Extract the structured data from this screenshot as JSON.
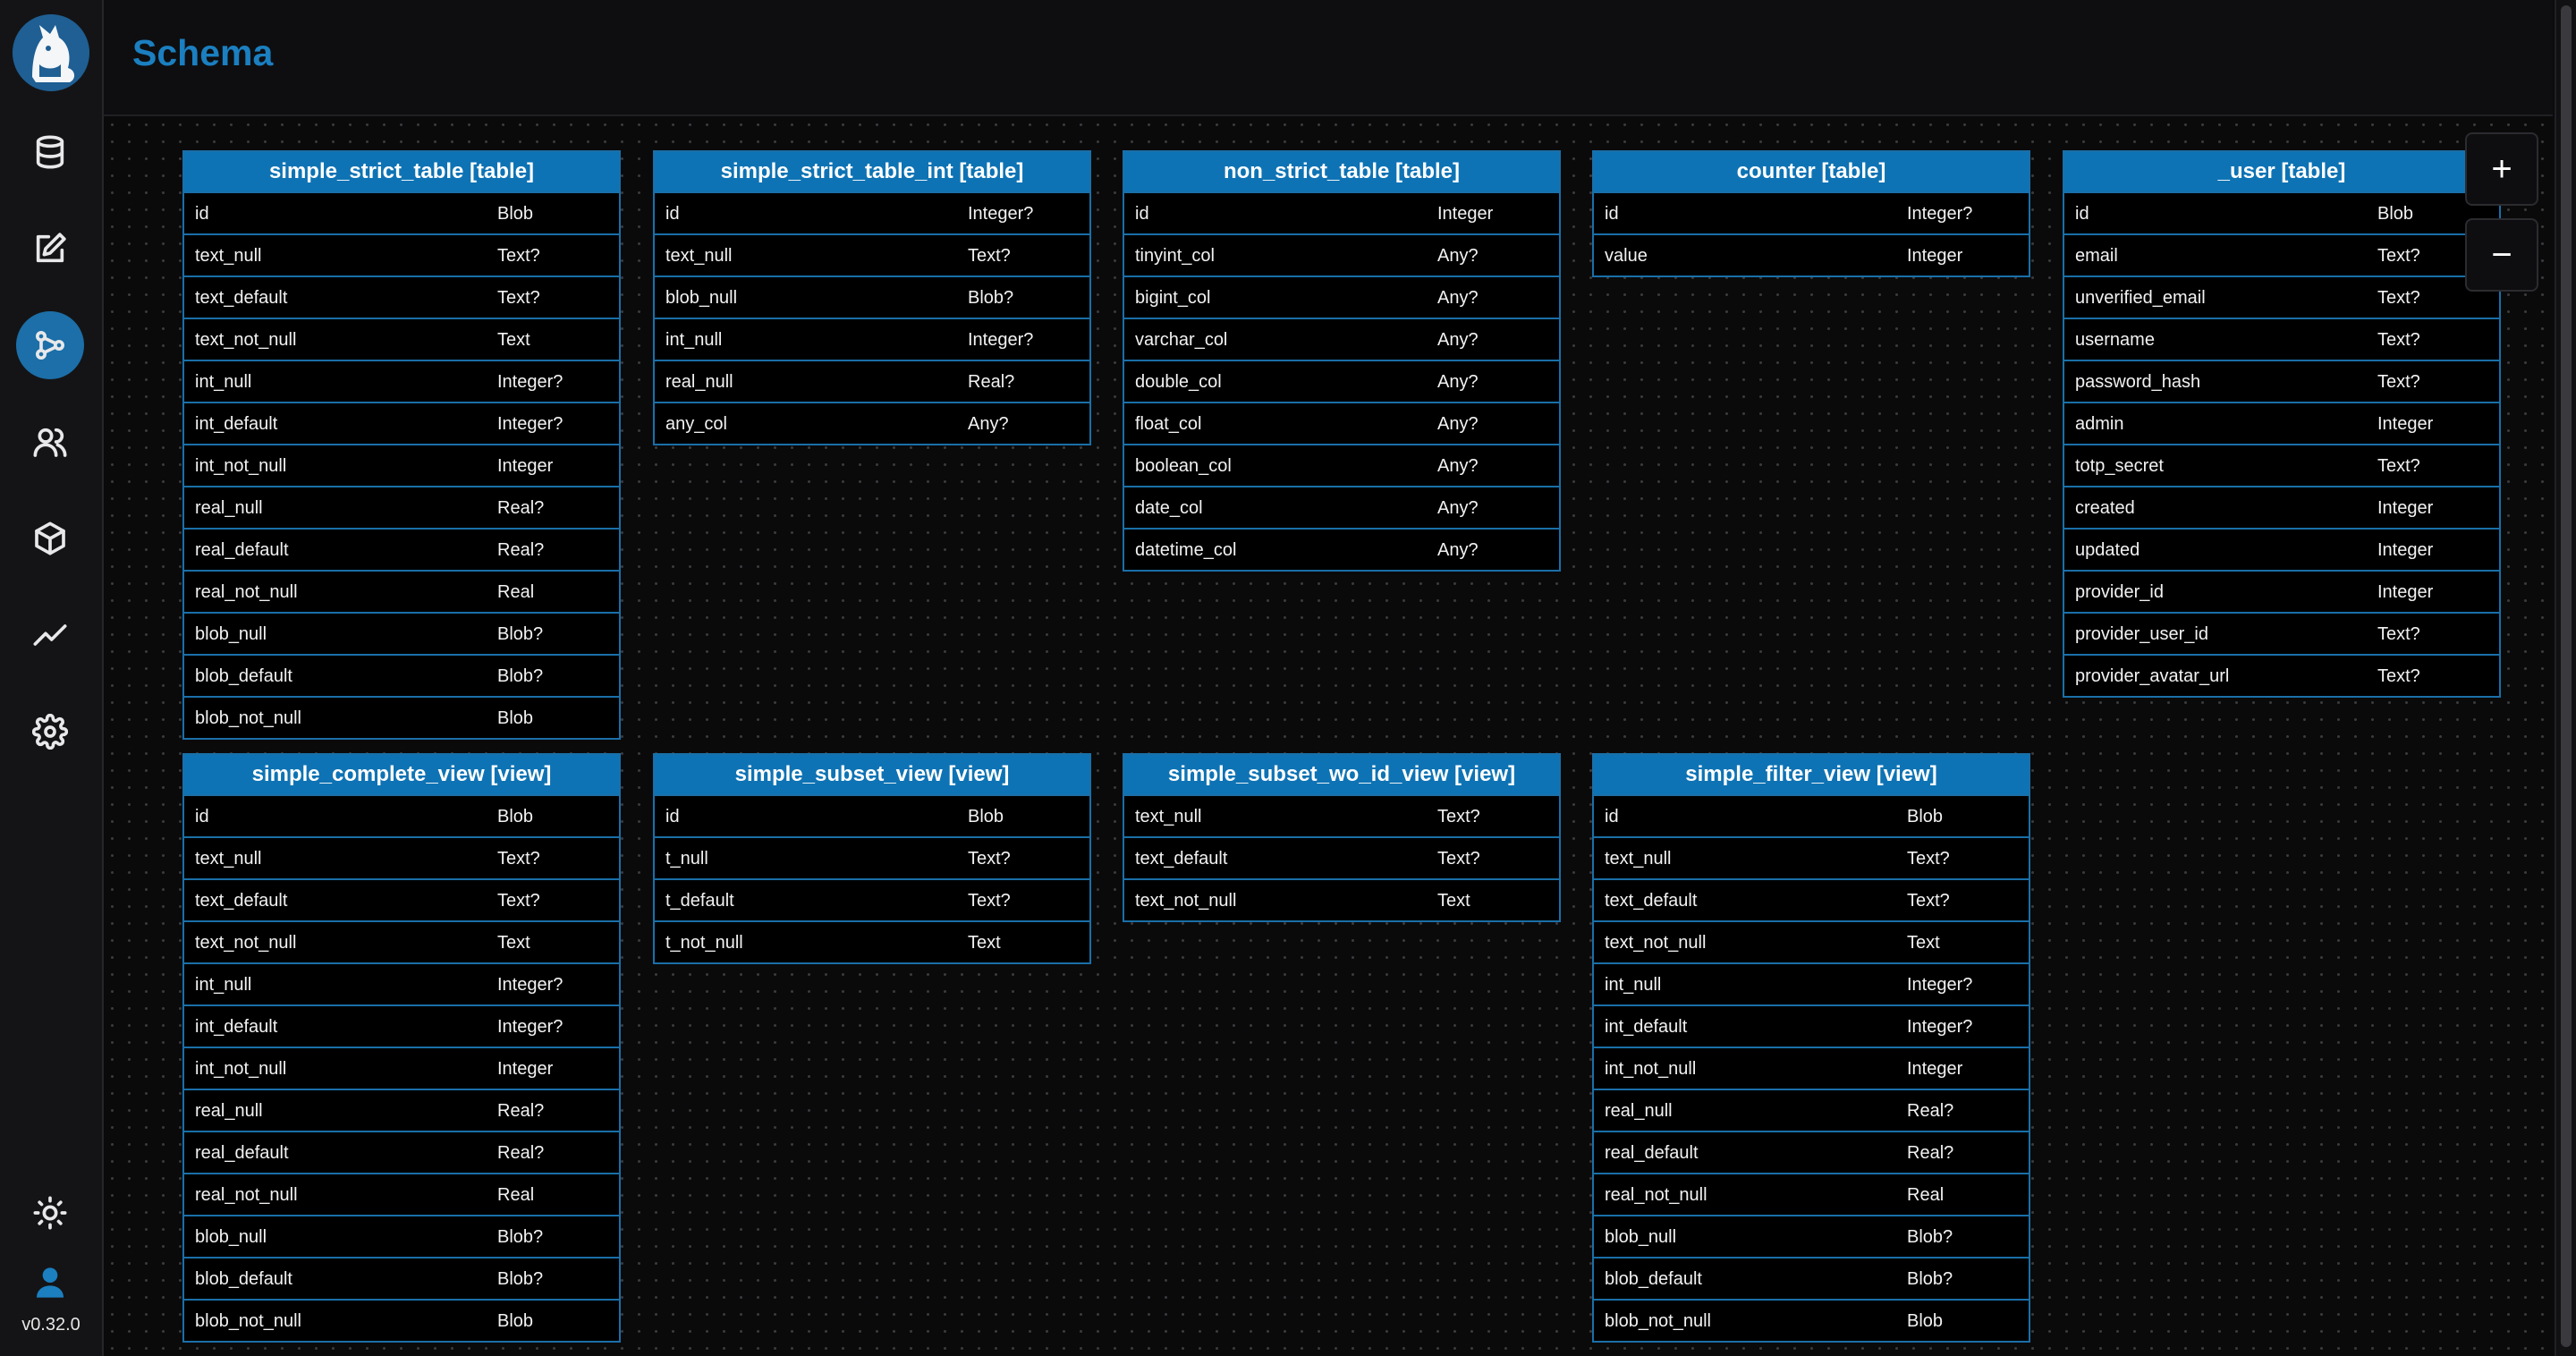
{
  "app": {
    "title": "Schema",
    "version": "v0.32.0"
  },
  "sidebar": {
    "items": [
      {
        "name": "database",
        "icon": "database-icon"
      },
      {
        "name": "editor",
        "icon": "edit-icon"
      },
      {
        "name": "schema",
        "icon": "share-nodes-icon",
        "active": true
      },
      {
        "name": "users",
        "icon": "users-icon"
      },
      {
        "name": "extensions",
        "icon": "box-icon"
      },
      {
        "name": "metrics",
        "icon": "trending-icon"
      },
      {
        "name": "settings",
        "icon": "gear-icon"
      }
    ],
    "bottom": [
      {
        "name": "theme",
        "icon": "sun-icon"
      },
      {
        "name": "account",
        "icon": "user-icon"
      }
    ]
  },
  "zoom": {
    "in_label": "+",
    "out_label": "−"
  },
  "colors": {
    "accent": "#0e73b4",
    "title": "#1b7fc0",
    "border": "#1a6fa8"
  },
  "tables": [
    {
      "title": "simple_strict_table [table]",
      "columns": [
        [
          "id",
          "Blob"
        ],
        [
          "text_null",
          "Text?"
        ],
        [
          "text_default",
          "Text?"
        ],
        [
          "text_not_null",
          "Text"
        ],
        [
          "int_null",
          "Integer?"
        ],
        [
          "int_default",
          "Integer?"
        ],
        [
          "int_not_null",
          "Integer"
        ],
        [
          "real_null",
          "Real?"
        ],
        [
          "real_default",
          "Real?"
        ],
        [
          "real_not_null",
          "Real"
        ],
        [
          "blob_null",
          "Blob?"
        ],
        [
          "blob_default",
          "Blob?"
        ],
        [
          "blob_not_null",
          "Blob"
        ]
      ]
    },
    {
      "title": "simple_strict_table_int [table]",
      "columns": [
        [
          "id",
          "Integer?"
        ],
        [
          "text_null",
          "Text?"
        ],
        [
          "blob_null",
          "Blob?"
        ],
        [
          "int_null",
          "Integer?"
        ],
        [
          "real_null",
          "Real?"
        ],
        [
          "any_col",
          "Any?"
        ]
      ]
    },
    {
      "title": "non_strict_table [table]",
      "columns": [
        [
          "id",
          "Integer"
        ],
        [
          "tinyint_col",
          "Any?"
        ],
        [
          "bigint_col",
          "Any?"
        ],
        [
          "varchar_col",
          "Any?"
        ],
        [
          "double_col",
          "Any?"
        ],
        [
          "float_col",
          "Any?"
        ],
        [
          "boolean_col",
          "Any?"
        ],
        [
          "date_col",
          "Any?"
        ],
        [
          "datetime_col",
          "Any?"
        ]
      ]
    },
    {
      "title": "counter [table]",
      "columns": [
        [
          "id",
          "Integer?"
        ],
        [
          "value",
          "Integer"
        ]
      ]
    },
    {
      "title": "_user [table]",
      "columns": [
        [
          "id",
          "Blob"
        ],
        [
          "email",
          "Text?"
        ],
        [
          "unverified_email",
          "Text?"
        ],
        [
          "username",
          "Text?"
        ],
        [
          "password_hash",
          "Text?"
        ],
        [
          "admin",
          "Integer"
        ],
        [
          "totp_secret",
          "Text?"
        ],
        [
          "created",
          "Integer"
        ],
        [
          "updated",
          "Integer"
        ],
        [
          "provider_id",
          "Integer"
        ],
        [
          "provider_user_id",
          "Text?"
        ],
        [
          "provider_avatar_url",
          "Text?"
        ]
      ]
    },
    {
      "title": "simple_complete_view [view]",
      "columns": [
        [
          "id",
          "Blob"
        ],
        [
          "text_null",
          "Text?"
        ],
        [
          "text_default",
          "Text?"
        ],
        [
          "text_not_null",
          "Text"
        ],
        [
          "int_null",
          "Integer?"
        ],
        [
          "int_default",
          "Integer?"
        ],
        [
          "int_not_null",
          "Integer"
        ],
        [
          "real_null",
          "Real?"
        ],
        [
          "real_default",
          "Real?"
        ],
        [
          "real_not_null",
          "Real"
        ],
        [
          "blob_null",
          "Blob?"
        ],
        [
          "blob_default",
          "Blob?"
        ],
        [
          "blob_not_null",
          "Blob"
        ]
      ]
    },
    {
      "title": "simple_subset_view [view]",
      "columns": [
        [
          "id",
          "Blob"
        ],
        [
          "t_null",
          "Text?"
        ],
        [
          "t_default",
          "Text?"
        ],
        [
          "t_not_null",
          "Text"
        ]
      ]
    },
    {
      "title": "simple_subset_wo_id_view [view]",
      "columns": [
        [
          "text_null",
          "Text?"
        ],
        [
          "text_default",
          "Text?"
        ],
        [
          "text_not_null",
          "Text"
        ]
      ]
    },
    {
      "title": "simple_filter_view [view]",
      "columns": [
        [
          "id",
          "Blob"
        ],
        [
          "text_null",
          "Text?"
        ],
        [
          "text_default",
          "Text?"
        ],
        [
          "text_not_null",
          "Text"
        ],
        [
          "int_null",
          "Integer?"
        ],
        [
          "int_default",
          "Integer?"
        ],
        [
          "int_not_null",
          "Integer"
        ],
        [
          "real_null",
          "Real?"
        ],
        [
          "real_default",
          "Real?"
        ],
        [
          "real_not_null",
          "Real"
        ],
        [
          "blob_null",
          "Blob?"
        ],
        [
          "blob_default",
          "Blob?"
        ],
        [
          "blob_not_null",
          "Blob"
        ]
      ]
    }
  ]
}
